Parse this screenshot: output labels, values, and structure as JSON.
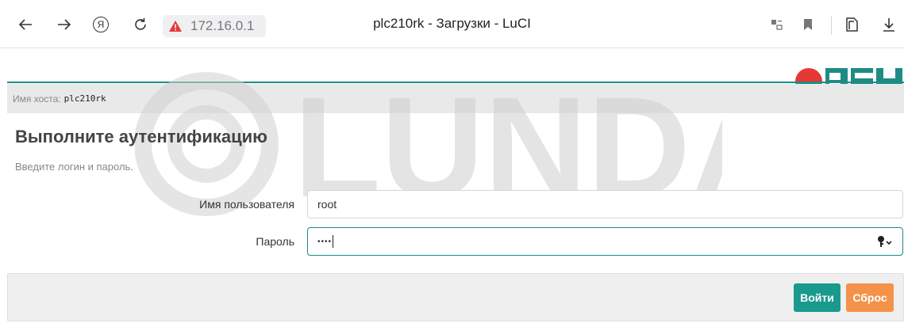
{
  "browser": {
    "url": "172.16.0.1",
    "tab_title": "plc210rk - Загрузки - LuCI",
    "yandex_icon_letter": "Я",
    "warning_color": "#e53935"
  },
  "header": {
    "logo_text": "ОВЕН",
    "brand_color": "#1e8c84",
    "logo_accent_color": "#e53935"
  },
  "hostbar": {
    "label": "Имя хоста:",
    "hostname": "plc210rk"
  },
  "main": {
    "title": "Выполните аутентификацию",
    "subtitle": "Введите логин и пароль.",
    "username_label": "Имя пользователя",
    "username_value": "root",
    "password_label": "Пароль",
    "password_mask": "••••"
  },
  "actions": {
    "login_label": "Войти",
    "reset_label": "Сброс",
    "login_color": "#1a9a8c",
    "reset_color": "#f4924a"
  },
  "watermark": {
    "text": "LUNDA"
  }
}
